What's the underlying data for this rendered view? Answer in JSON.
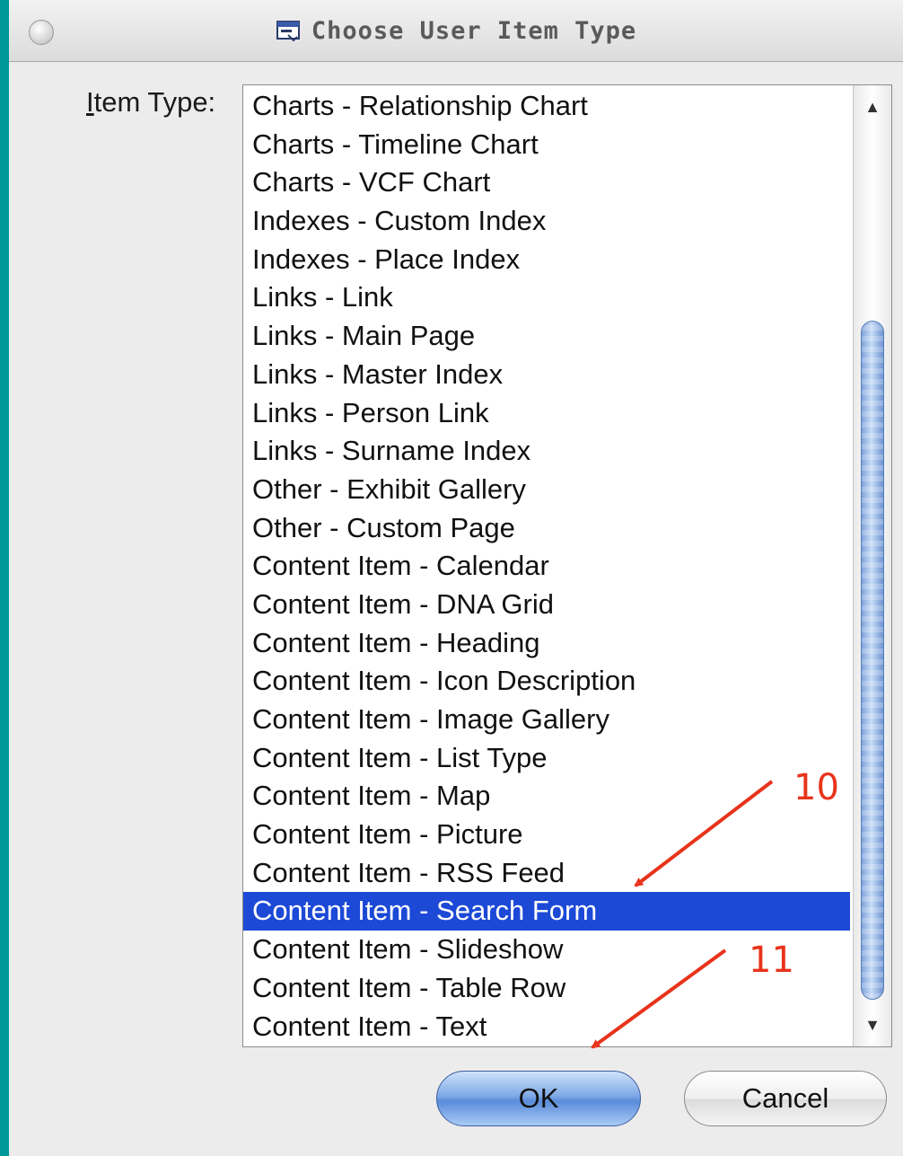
{
  "window": {
    "title": "Choose User Item Type"
  },
  "form": {
    "label_first": "I",
    "label_rest": "tem Type:"
  },
  "list": {
    "items": [
      "Charts - Relationship Chart",
      "Charts - Timeline Chart",
      "Charts - VCF Chart",
      "Indexes - Custom Index",
      "Indexes - Place Index",
      "Links - Link",
      "Links - Main Page",
      "Links - Master Index",
      "Links - Person Link",
      "Links - Surname Index",
      "Other - Exhibit Gallery",
      "Other - Custom Page",
      "Content Item - Calendar",
      "Content Item - DNA Grid",
      "Content Item - Heading",
      "Content Item - Icon Description",
      "Content Item - Image Gallery",
      "Content Item - List Type",
      "Content Item - Map",
      "Content Item - Picture",
      "Content Item - RSS Feed",
      "Content Item - Search Form",
      "Content Item - Slideshow",
      "Content Item - Table Row",
      "Content Item - Text"
    ],
    "selected_index": 21
  },
  "buttons": {
    "ok_label": "OK",
    "cancel_label": "Cancel"
  },
  "annotations": {
    "step_a": "10",
    "step_b": "11",
    "color": "#e8331b"
  },
  "colors": {
    "selection": "#1c49d6",
    "desktop": "#00999a"
  }
}
